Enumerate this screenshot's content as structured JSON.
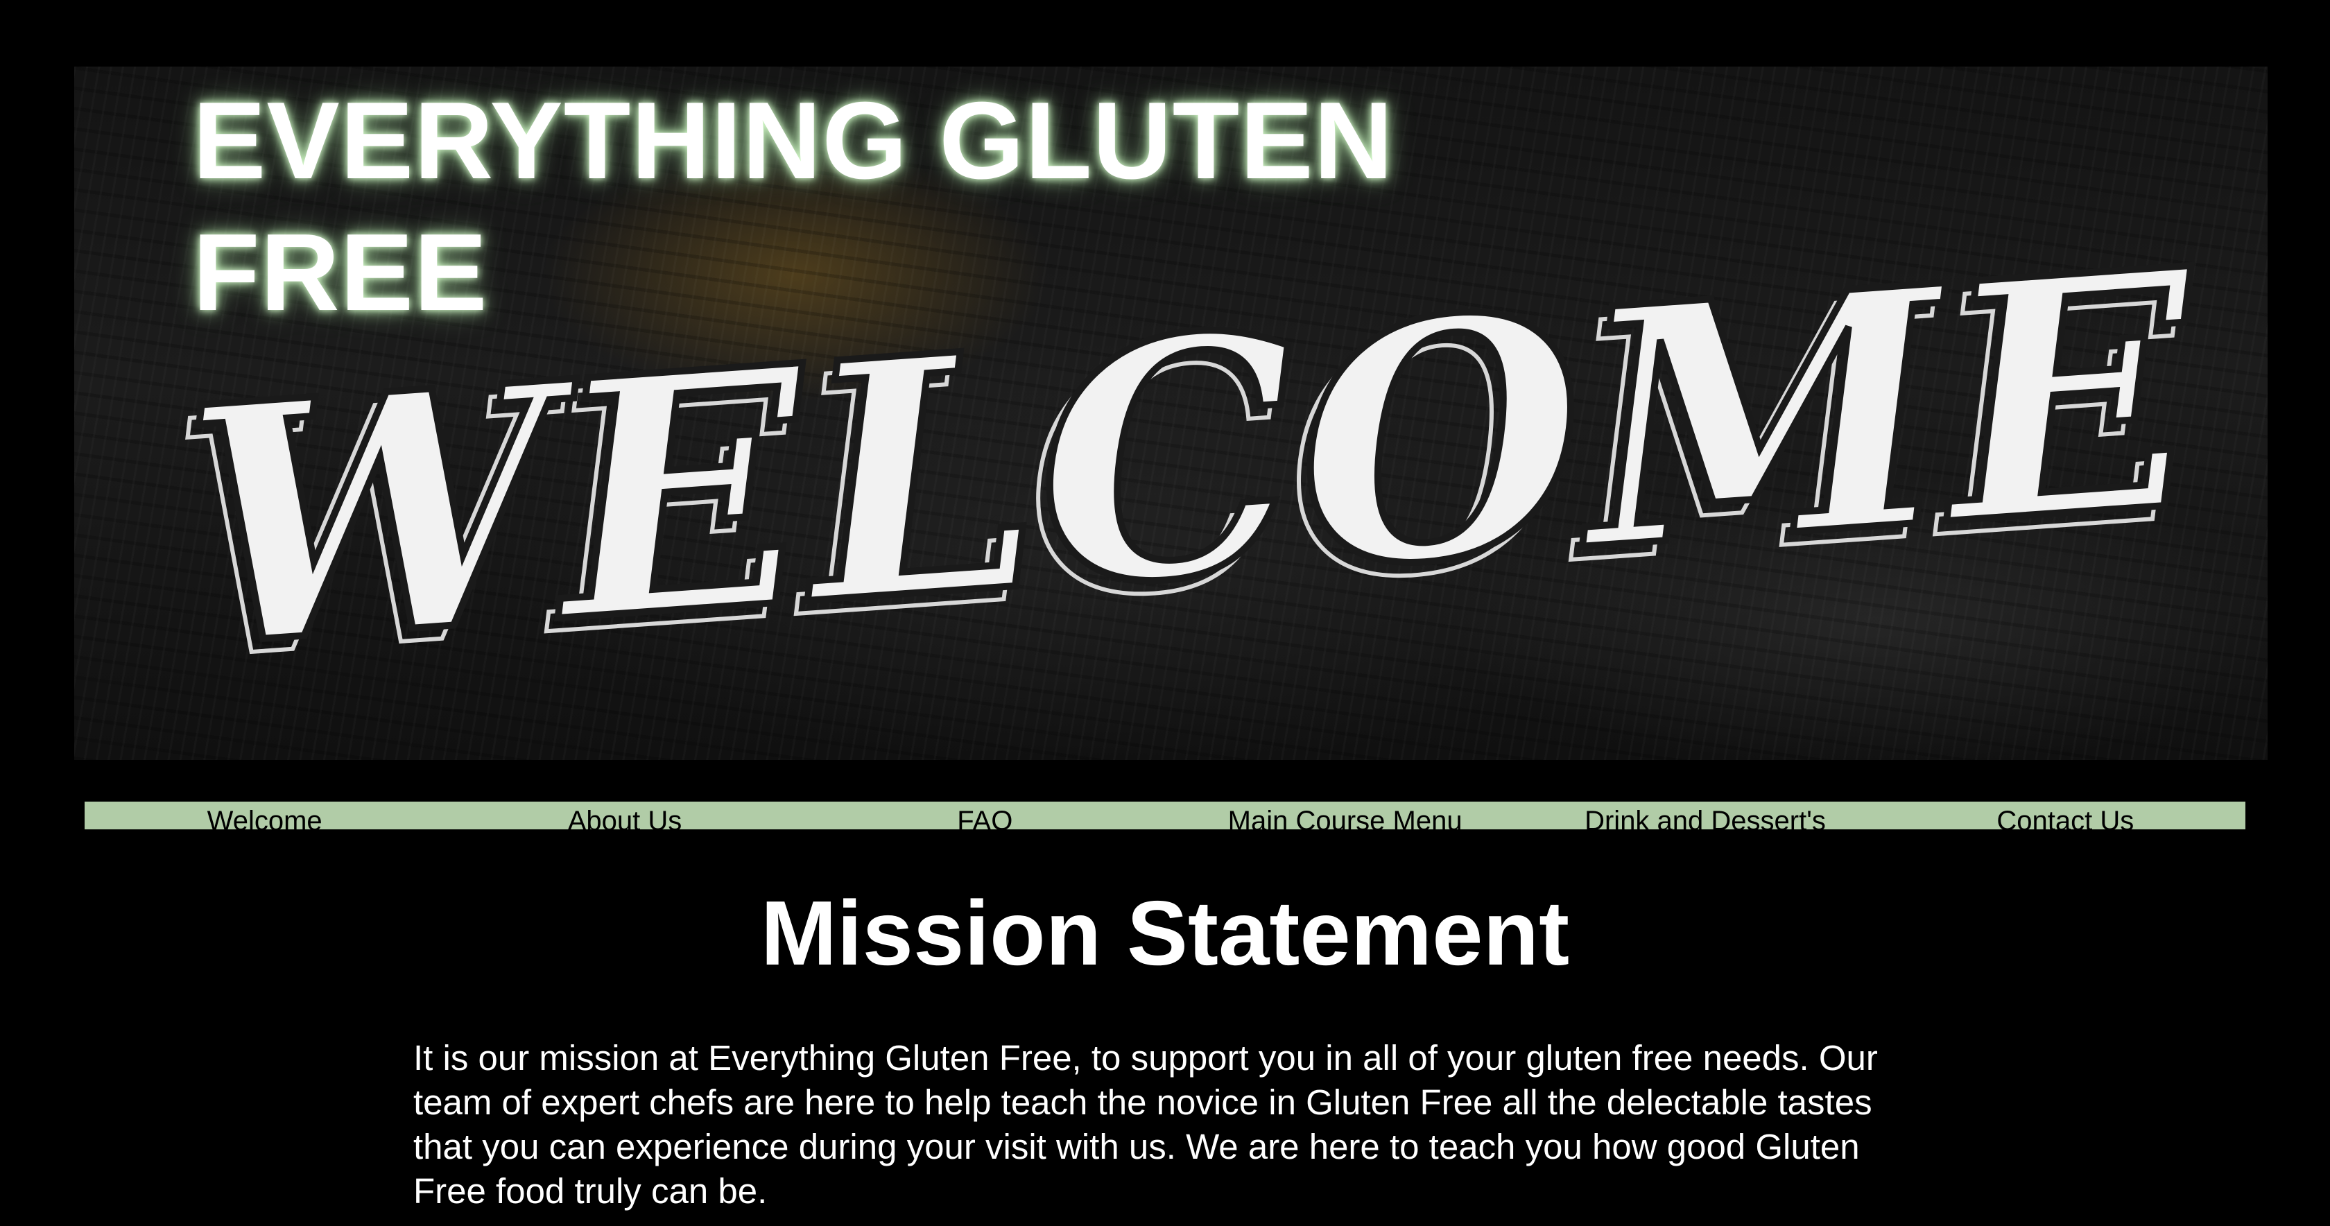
{
  "site": {
    "title": "EVERYTHING GLUTEN FREE",
    "hero_sign_text": "WELCOME"
  },
  "nav": {
    "items": [
      {
        "label": "Welcome"
      },
      {
        "label": "About Us"
      },
      {
        "label": "FAQ"
      },
      {
        "label": "Main Course Menu"
      },
      {
        "label": "Drink and Dessert's"
      },
      {
        "label": "Contact Us"
      }
    ]
  },
  "mission": {
    "heading": "Mission Statement",
    "body": "It is our mission at Everything Gluten Free, to support you in all of your gluten free needs. Our team of expert chefs are here to help teach the novice in Gluten Free all the delectable tastes that you can experience during your visit with us. We are here to teach you how good Gluten Free food truly can be."
  },
  "colors": {
    "background": "#000000",
    "nav_background": "#b1cca7",
    "text": "#ffffff",
    "nav_text": "#000000"
  }
}
